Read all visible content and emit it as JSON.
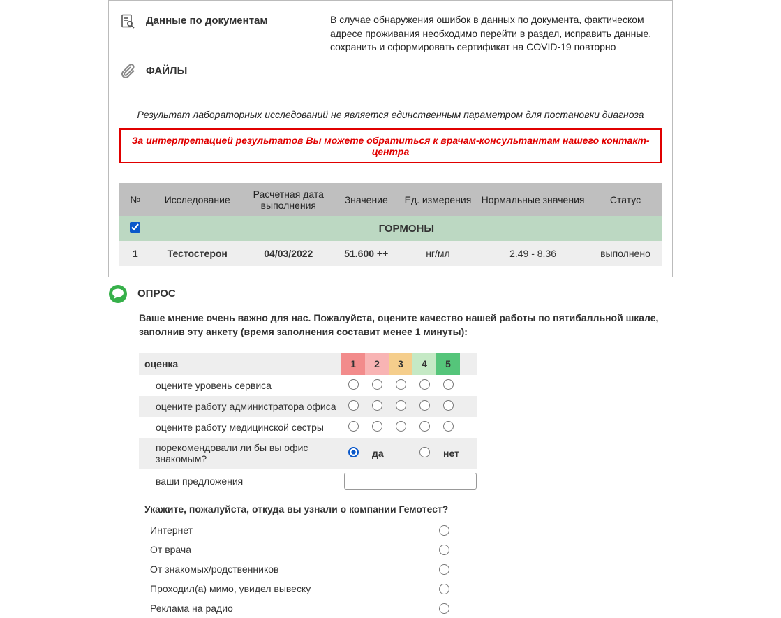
{
  "doc_section": {
    "title": "Данные по документам",
    "description": "В случае обнаружения ошибок в данных по документа, фактическом адресе проживания необходимо перейти в раздел, исправить данные, сохранить и сформировать сертификат на COVID-19 повторно"
  },
  "files_label": "ФАЙЛЫ",
  "italic_note": "Результат лабораторных исследований не является единственным параметром для постановки диагноза",
  "red_note": "За интерпретацией результатов Вы можете обратиться к врачам-консультантам нашего контакт-центра",
  "table": {
    "headers": {
      "num": "№",
      "study": "Исследование",
      "date": "Расчетная дата выполнения",
      "value": "Значение",
      "unit": "Ед. измерения",
      "norm": "Нормальные значения",
      "status": "Статус"
    },
    "category": "ГОРМОНЫ",
    "rows": [
      {
        "num": "1",
        "study": "Тестостерон",
        "date": "04/03/2022",
        "value": "51.600 ++",
        "unit": "нг/мл",
        "norm": "2.49 - 8.36",
        "status": "выполнено"
      }
    ]
  },
  "survey": {
    "title": "ОПРОС",
    "intro": "Ваше мнение очень важно для нас. Пожалуйста, оцените качество нашей работы по пятибалльной шкале, заполнив эту анкету (время заполнения составит менее 1 минуты):",
    "score_header": "оценка",
    "scores": [
      "1",
      "2",
      "3",
      "4",
      "5"
    ],
    "questions": [
      "оцените уровень сервиса",
      "оцените работу администратора офиса",
      "оцените работу медицинской сестры"
    ],
    "recommend": {
      "question": "порекомендовали ли бы вы офис знакомым?",
      "yes": "да",
      "no": "нет"
    },
    "suggestions_label": "ваши предложения",
    "suggestions_value": "",
    "source_header": "Укажите, пожалуйста, откуда вы узнали о компании Гемотест?",
    "sources": [
      "Интернет",
      "От врача",
      "От знакомых/родственников",
      "Проходил(а) мимо, увидел вывеску",
      "Реклама на радио"
    ]
  }
}
